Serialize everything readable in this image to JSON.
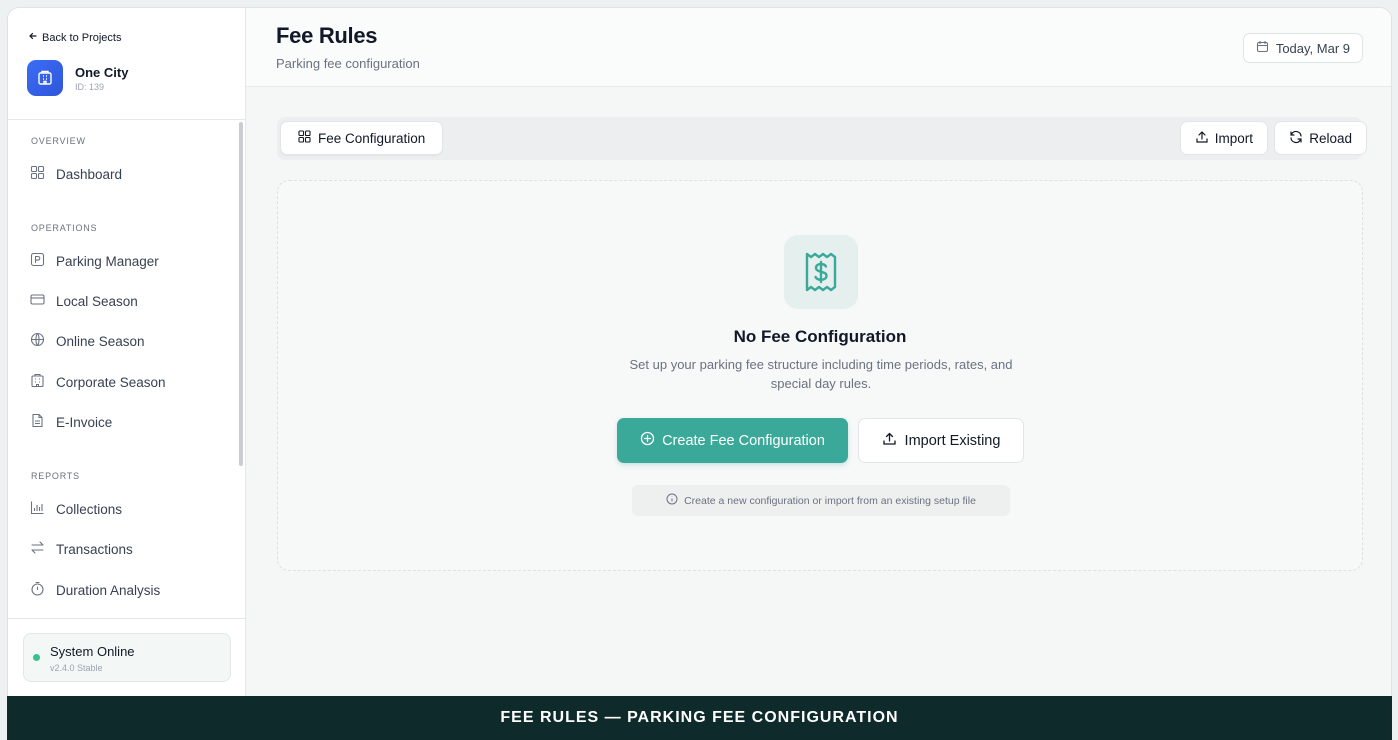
{
  "sidebar": {
    "back_label": "Back to Projects",
    "project": {
      "name": "One City",
      "id": "ID: 139"
    },
    "sections": {
      "overview": "OVERVIEW",
      "operations": "OPERATIONS",
      "reports": "REPORTS"
    },
    "items": {
      "dashboard": "Dashboard",
      "parking_manager": "Parking Manager",
      "local_season": "Local Season",
      "online_season": "Online Season",
      "corporate_season": "Corporate Season",
      "e_invoice": "E-Invoice",
      "collections": "Collections",
      "transactions": "Transactions",
      "duration_analysis": "Duration Analysis"
    },
    "status": {
      "title": "System Online",
      "version": "v2.4.0 Stable",
      "color": "#34c38f"
    }
  },
  "header": {
    "title": "Fee Rules",
    "subtitle": "Parking fee configuration",
    "date_label": "Today, Mar 9"
  },
  "toolbar": {
    "tab_label": "Fee Configuration",
    "import_label": "Import",
    "reload_label": "Reload"
  },
  "empty_state": {
    "title": "No Fee Configuration",
    "description": "Set up your parking fee structure including time periods, rates, and special day rules.",
    "create_label": "Create Fee Configuration",
    "import_label": "Import Existing",
    "hint": "Create a new configuration or import from an existing setup file",
    "accent_color": "#3aa99a"
  },
  "banner": {
    "text": "FEE RULES — PARKING FEE CONFIGURATION"
  }
}
